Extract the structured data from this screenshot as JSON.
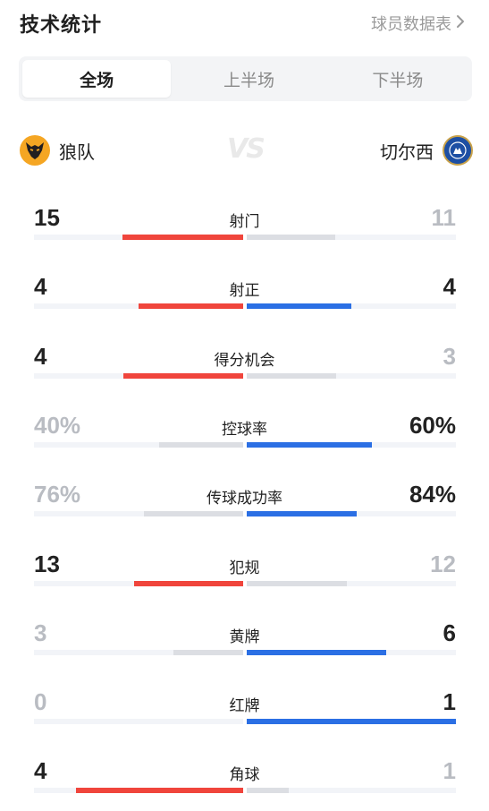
{
  "header": {
    "title": "技术统计",
    "more_label": "球员数据表"
  },
  "tabs": [
    {
      "label": "全场",
      "active": true
    },
    {
      "label": "上半场",
      "active": false
    },
    {
      "label": "下半场",
      "active": false
    }
  ],
  "teams": {
    "home": {
      "name": "狼队",
      "logo": "wolves-logo-icon"
    },
    "vs": "VS",
    "away": {
      "name": "切尔西",
      "logo": "chelsea-logo-icon"
    }
  },
  "colors": {
    "home": "#f0453c",
    "away": "#2b6fe4",
    "neutral": "#dcdee3"
  },
  "stats": [
    {
      "label": "射门",
      "home": "15",
      "away": "11",
      "home_val": 15,
      "away_val": 11,
      "leader": "home"
    },
    {
      "label": "射正",
      "home": "4",
      "away": "4",
      "home_val": 4,
      "away_val": 4,
      "leader": "both"
    },
    {
      "label": "得分机会",
      "home": "4",
      "away": "3",
      "home_val": 4,
      "away_val": 3,
      "leader": "home"
    },
    {
      "label": "控球率",
      "home": "40%",
      "away": "60%",
      "home_val": 40,
      "away_val": 60,
      "leader": "away"
    },
    {
      "label": "传球成功率",
      "home": "76%",
      "away": "84%",
      "home_val": 76,
      "away_val": 84,
      "leader": "away"
    },
    {
      "label": "犯规",
      "home": "13",
      "away": "12",
      "home_val": 13,
      "away_val": 12,
      "leader": "home"
    },
    {
      "label": "黄牌",
      "home": "3",
      "away": "6",
      "home_val": 3,
      "away_val": 6,
      "leader": "away"
    },
    {
      "label": "红牌",
      "home": "0",
      "away": "1",
      "home_val": 0,
      "away_val": 1,
      "leader": "away"
    },
    {
      "label": "角球",
      "home": "4",
      "away": "1",
      "home_val": 4,
      "away_val": 1,
      "leader": "home"
    }
  ]
}
